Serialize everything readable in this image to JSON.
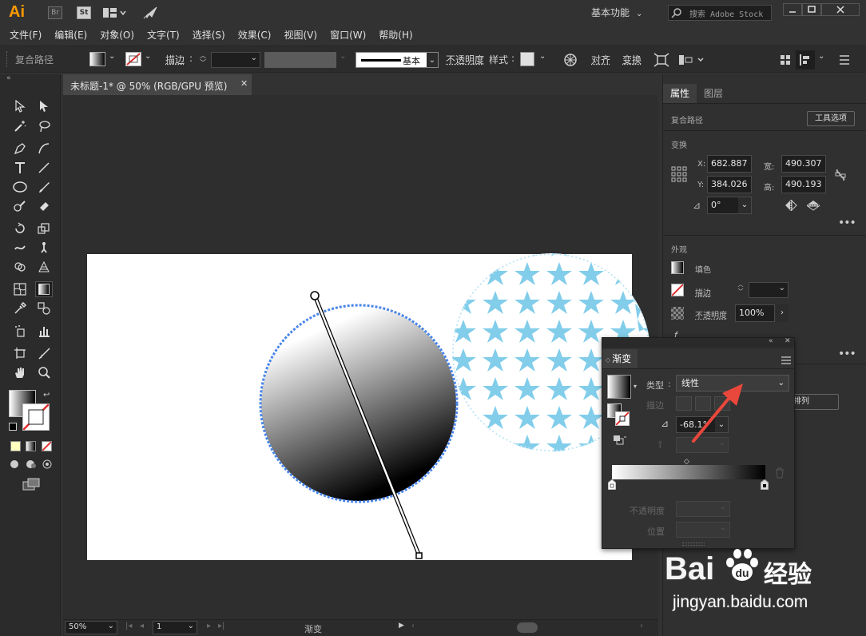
{
  "app": {
    "logo": "Ai",
    "bridge_label": "Br",
    "stock_label": "St",
    "workspace": "基本功能",
    "search_placeholder": "搜索 Adobe Stock"
  },
  "menu": [
    "文件(F)",
    "编辑(E)",
    "对象(O)",
    "文字(T)",
    "选择(S)",
    "效果(C)",
    "视图(V)",
    "窗口(W)",
    "帮助(H)"
  ],
  "control_bar": {
    "object_type": "复合路径",
    "stroke_label": "描边",
    "stroke_style": "基本",
    "opacity_label": "不透明度",
    "style_label": "样式",
    "align_label": "对齐",
    "transform_label": "变换"
  },
  "document": {
    "tab_title": "未标题-1* @ 50% (RGB/GPU 预览)",
    "zoom": "50%",
    "artboard_number": "1",
    "status_text": "渐变"
  },
  "properties_panel": {
    "tabs": [
      "属性",
      "图层"
    ],
    "object_type": "复合路径",
    "tool_options_button": "工具选项",
    "transform_title": "变换",
    "x_label": "X:",
    "x_value": "682.887",
    "y_label": "Y:",
    "y_value": "384.026",
    "width_label": "宽:",
    "width_value": "490.307",
    "height_label": "高:",
    "height_value": "490.193",
    "rotate_value": "0°",
    "appearance_title": "外观",
    "fill_label": "填色",
    "stroke_label": "描边",
    "opacity_label": "不透明度",
    "opacity_value": "100%",
    "arrange_label": "排列"
  },
  "gradient_panel": {
    "title": "渐变",
    "type_label": "类型",
    "type_value": "线性",
    "stroke_label": "描边",
    "angle_value": "-68.1°",
    "opacity_label": "不透明度",
    "location_label": "位置"
  },
  "watermark": {
    "brand": "Bai",
    "brand_suffix": "经验",
    "url": "jingyan.baidu.com"
  },
  "colors": {
    "accent_blue": "#4a86e8",
    "star_pattern": "#82cdea",
    "arrow_red": "#e8473b",
    "ai_orange": "#ff9a00"
  }
}
